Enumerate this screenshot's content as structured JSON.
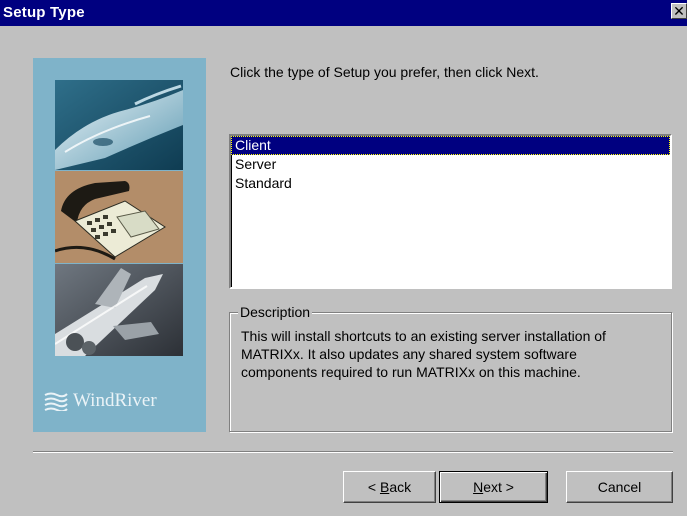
{
  "window": {
    "title": "Setup Type",
    "close_glyph": "✕"
  },
  "sidebar": {
    "logo_text": "WindRiver",
    "images": [
      "car-image",
      "telephone-image",
      "space-shuttle-image"
    ]
  },
  "main": {
    "prompt": "Click the type of Setup you prefer, then click Next.",
    "setup_types": [
      {
        "label": "Client",
        "selected": true
      },
      {
        "label": "Server",
        "selected": false
      },
      {
        "label": "Standard",
        "selected": false
      }
    ],
    "description": {
      "legend": "Description",
      "text_lines": [
        "This will install shortcuts to an existing server installation of",
        "MATRIXx.  It also updates any shared system software",
        "components required to run MATRIXx on this machine."
      ]
    }
  },
  "buttons": {
    "back": {
      "prefix": "< ",
      "mnemonic": "B",
      "rest": "ack"
    },
    "next": {
      "mnemonic": "N",
      "rest": "ext >"
    },
    "cancel": "Cancel"
  },
  "colors": {
    "titlebar": "#000080",
    "window_bg": "#c0c0c0",
    "art_bg": "#7fb3c9",
    "selection": "#000080"
  }
}
